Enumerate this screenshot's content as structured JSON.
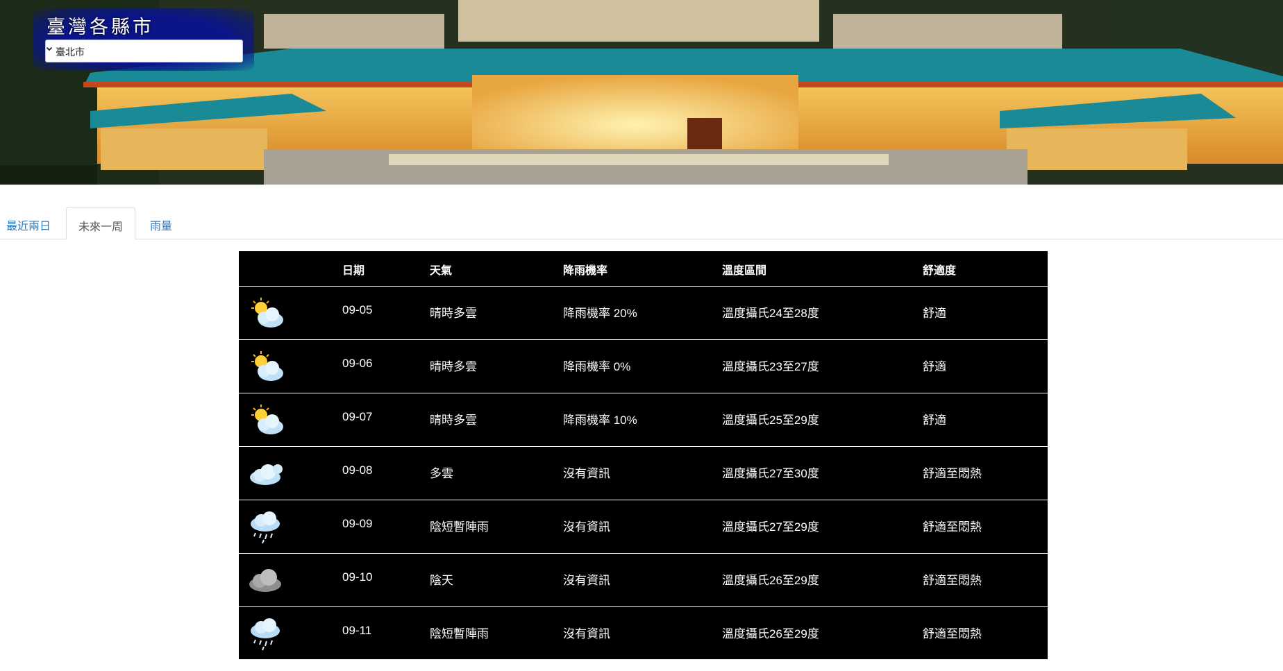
{
  "header": {
    "title": "臺灣各縣市",
    "city_select": {
      "selected": "臺北市"
    }
  },
  "tabs": [
    {
      "label": "最近兩日",
      "active": false
    },
    {
      "label": "未來一周",
      "active": true
    },
    {
      "label": "雨量",
      "active": false
    }
  ],
  "forecast": {
    "columns": [
      "",
      "日期",
      "天氣",
      "降雨機率",
      "溫度區間",
      "舒適度"
    ],
    "rows": [
      {
        "icon": "partly-cloudy-icon",
        "date": "09-05",
        "weather": "晴時多雲",
        "rain": "降雨機率 20%",
        "temp": "溫度攝氏24至28度",
        "comfort": "舒適"
      },
      {
        "icon": "partly-cloudy-icon",
        "date": "09-06",
        "weather": "晴時多雲",
        "rain": "降雨機率 0%",
        "temp": "溫度攝氏23至27度",
        "comfort": "舒適"
      },
      {
        "icon": "partly-cloudy-icon",
        "date": "09-07",
        "weather": "晴時多雲",
        "rain": "降雨機率 10%",
        "temp": "溫度攝氏25至29度",
        "comfort": "舒適"
      },
      {
        "icon": "cloudy-icon",
        "date": "09-08",
        "weather": "多雲",
        "rain": "沒有資訊",
        "temp": "溫度攝氏27至30度",
        "comfort": "舒適至悶熱"
      },
      {
        "icon": "rain-cloud-icon",
        "date": "09-09",
        "weather": "陰短暫陣雨",
        "rain": "沒有資訊",
        "temp": "溫度攝氏27至29度",
        "comfort": "舒適至悶熱"
      },
      {
        "icon": "overcast-icon",
        "date": "09-10",
        "weather": "陰天",
        "rain": "沒有資訊",
        "temp": "溫度攝氏26至29度",
        "comfort": "舒適至悶熱"
      },
      {
        "icon": "rain-cloud-icon",
        "date": "09-11",
        "weather": "陰短暫陣雨",
        "rain": "沒有資訊",
        "temp": "溫度攝氏26至29度",
        "comfort": "舒適至悶熱"
      }
    ]
  },
  "colors": {
    "link": "#337ab7",
    "table_bg": "#000000",
    "title_box": "#0a148c"
  }
}
